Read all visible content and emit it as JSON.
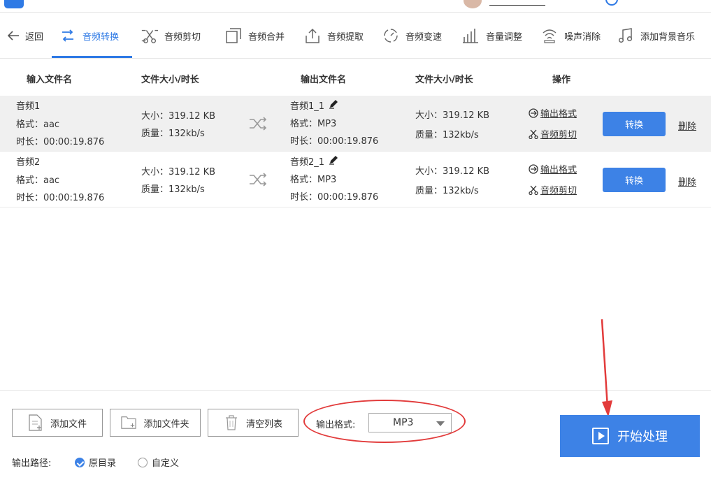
{
  "colors": {
    "accent": "#2f7ae5",
    "button": "#3d82e6",
    "annotation": "#e23b3b"
  },
  "toolbar": {
    "back_label": "返回",
    "tabs": [
      {
        "label": "音频转换",
        "icon": "convert-arrows-icon",
        "active": true
      },
      {
        "label": "音频剪切",
        "icon": "scissors-icon"
      },
      {
        "label": "音频合并",
        "icon": "merge-icon"
      },
      {
        "label": "音频提取",
        "icon": "export-icon"
      },
      {
        "label": "音频变速",
        "icon": "speed-icon"
      },
      {
        "label": "音量调整",
        "icon": "volume-bars-icon"
      },
      {
        "label": "噪声消除",
        "icon": "noise-icon"
      },
      {
        "label": "添加背景音乐",
        "icon": "music-note-icon"
      }
    ]
  },
  "table": {
    "headers": {
      "input_name": "输入文件名",
      "size_duration_in": "文件大小/时长",
      "output_name": "输出文件名",
      "size_duration_out": "文件大小/时长",
      "actions": "操作"
    },
    "rows": [
      {
        "name": "音频1",
        "format": "格式：aac",
        "duration": "时长：00:00:19.876",
        "size": "大小：319.12 KB",
        "quality": "质量：132kb/s",
        "out_name": "音频1_1",
        "out_format": "格式：MP3",
        "out_duration": "时长：00:00:19.876",
        "out_size": "大小：319.12 KB",
        "out_quality": "质量：132kb/s",
        "action_format": "输出格式",
        "action_cut": "音频剪切",
        "convert": "转换",
        "delete": "删除"
      },
      {
        "name": "音频2",
        "format": "格式：aac",
        "duration": "时长：00:00:19.876",
        "size": "大小：319.12 KB",
        "quality": "质量：132kb/s",
        "out_name": "音频2_1",
        "out_format": "格式：MP3",
        "out_duration": "时长：00:00:19.876",
        "out_size": "大小：319.12 KB",
        "out_quality": "质量：132kb/s",
        "action_format": "输出格式",
        "action_cut": "音频剪切",
        "convert": "转换",
        "delete": "删除"
      }
    ]
  },
  "bottom": {
    "add_file": "添加文件",
    "add_folder": "添加文件夹",
    "clear_list": "清空列表",
    "format_label": "输出格式:",
    "format_value": "MP3",
    "start": "开始处理",
    "path_label": "输出路径:",
    "path_original": "原目录",
    "path_custom": "自定义",
    "path_selected": "原目录"
  }
}
